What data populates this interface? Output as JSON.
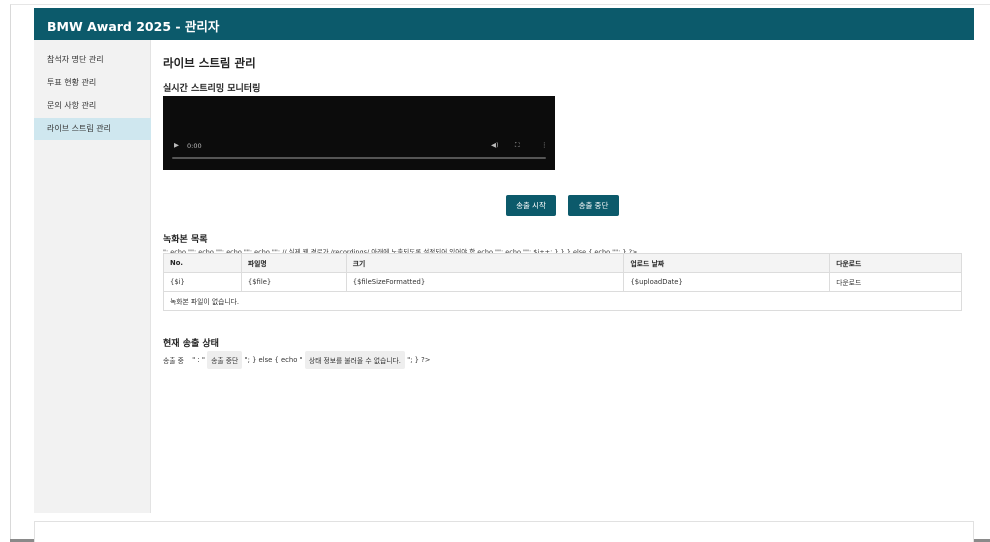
{
  "app": {
    "title": "BMW Award 2025 - 관리자"
  },
  "sidebar": {
    "items": [
      {
        "label": "참석자 명단 관리"
      },
      {
        "label": "투표 현황 관리"
      },
      {
        "label": "문의 사항 관리"
      },
      {
        "label": "라이브 스트림 관리"
      }
    ],
    "active_index": 3
  },
  "main": {
    "page_title": "라이브 스트림 관리",
    "monitor_title": "실시간 스트리밍 모니터링",
    "video": {
      "time": "0:00"
    },
    "buttons": {
      "start": "송출 시작",
      "stop": "송출 중단"
    },
    "recordings": {
      "title": "녹화본 목록",
      "raw_code": "\"; echo \"\"; echo \"\"; echo \"\"; echo \"\"; // 실제 웹 경로가 /recordings/ 아래에 노출되도록 설정되어 있어야 함 echo \"\"; echo \"\"; $i++; } } } else { echo \"\"; } ?>",
      "columns": [
        "No.",
        "파일명",
        "크기",
        "업로드 날짜",
        "다운로드"
      ],
      "rows": [
        [
          "{$i}",
          "{$file}",
          "{$fileSizeFormatted}",
          "{$uploadDate}",
          "다운로드"
        ]
      ],
      "empty_message": "녹화본 파일이 없습니다."
    },
    "status": {
      "title": "현재 송출 상태",
      "prefix": "송출 중",
      "part1": "\" : \"",
      "chip1": "송출 중단",
      "part2": "\"; } else { echo \"",
      "chip2": "상태 정보를 불러올 수 없습니다.",
      "part3": "\"; } ?>"
    }
  },
  "colors": {
    "brand": "#0c5a6b",
    "sidebar_active": "#cfe7ef"
  }
}
